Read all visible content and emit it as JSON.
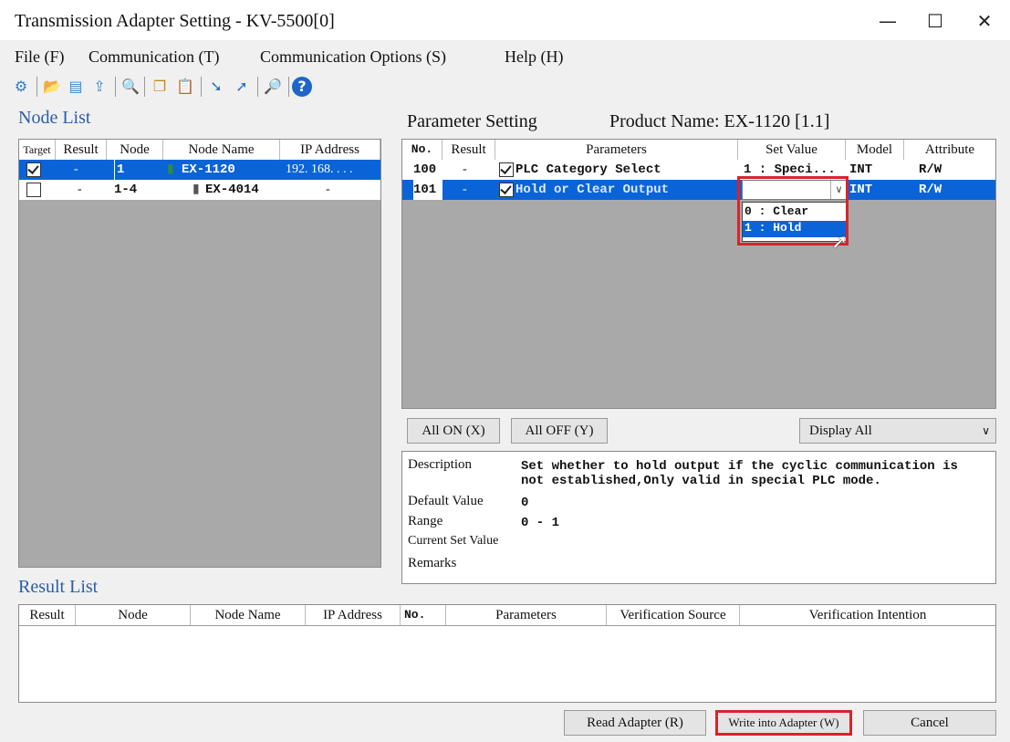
{
  "window": {
    "title": "Transmission Adapter Setting - KV-5500[0]",
    "minimize": "—",
    "maximize": "☐",
    "close": "✕"
  },
  "menu": [
    "File (F)",
    "Communication (T)",
    "Communication Options (S)",
    "Help (H)"
  ],
  "toolbar_icons": [
    "connect-icon",
    "open-folder-icon",
    "save-icon",
    "upload-icon",
    "preview-icon",
    "copy-icon",
    "paste-icon",
    "read-icon",
    "write-icon",
    "search-icon",
    "help-icon"
  ],
  "node_list": {
    "title": "Node List",
    "columns": [
      "Target",
      "Result",
      "Node",
      "Node Name",
      "IP Address"
    ],
    "rows": [
      {
        "target": true,
        "result": "-",
        "node": "1",
        "name": "EX-1120",
        "ip": "192. 168. . . .",
        "selected": true
      },
      {
        "target": false,
        "result": "-",
        "node": "1-4",
        "name": "EX-4014",
        "ip": "-",
        "selected": false
      }
    ]
  },
  "param": {
    "title": "Parameter Setting",
    "product_label": "Product Name: EX-1120 [1.1]",
    "columns": [
      "No.",
      "Result",
      "Parameters",
      "Set Value",
      "Model",
      "Attribute"
    ],
    "rows": [
      {
        "no": "100",
        "result": "-",
        "param": "PLC Category Select",
        "value": "1 : Speci...",
        "model": "INT",
        "attr": "R/W",
        "selected": false
      },
      {
        "no": "101",
        "result": "-",
        "param": "Hold or Clear Output",
        "value": "",
        "model": "INT",
        "attr": "R/W",
        "selected": true
      }
    ],
    "dropdown_options": [
      "0 : Clear",
      "1 : Hold"
    ],
    "all_on": "All ON (X)",
    "all_off": "All OFF (Y)",
    "display": "Display All"
  },
  "description": {
    "labels": {
      "description": "Description",
      "default": "Default Value",
      "range": "Range",
      "current": "Current Set Value",
      "remarks": "Remarks"
    },
    "text1": "Set whether to hold output if the cyclic communication is",
    "text2": "not established,Only valid in special PLC mode.",
    "default_value": "0",
    "range": "0 - 1"
  },
  "result_list": {
    "title": "Result List",
    "columns": [
      "Result",
      "Node",
      "Node Name",
      "IP Address",
      "No.",
      "Parameters",
      "Verification Source",
      "Verification Intention"
    ]
  },
  "footer": {
    "read": "Read Adapter (R)",
    "write": "Write into Adapter (W)",
    "cancel": "Cancel"
  },
  "colors": {
    "selection": "#0a64d8",
    "highlight_box": "#d9232b",
    "title_blue": "#2a5ea8"
  }
}
